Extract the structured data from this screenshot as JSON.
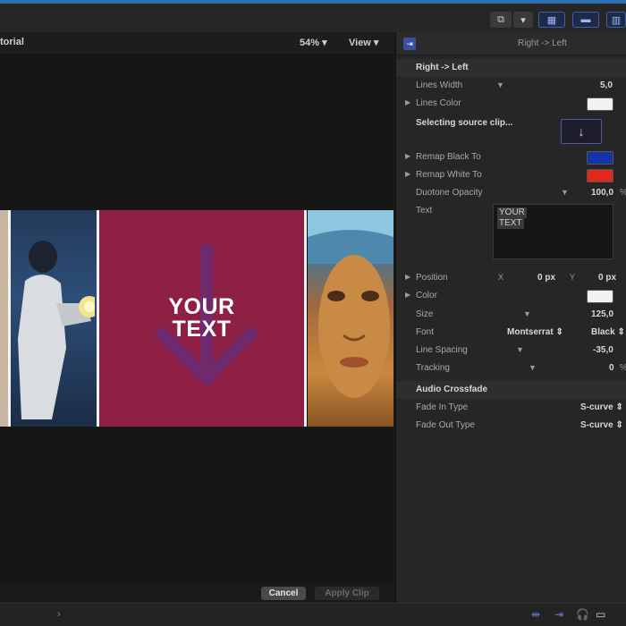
{
  "viewer": {
    "title": "torial",
    "zoom": "54%",
    "view_label": "View",
    "overlay_text_line1": "YOUR",
    "overlay_text_line2": "TEXT"
  },
  "actions": {
    "cancel": "Cancel",
    "apply": "Apply Clip"
  },
  "inspector": {
    "header_title": "Right -> Left",
    "section_title": "Right -> Left",
    "lines_width_label": "Lines Width",
    "lines_width_value": "5,0",
    "lines_color_label": "Lines Color",
    "lines_color": "#f2f2f2",
    "source_clip_label": "Selecting source clip...",
    "remap_black_label": "Remap Black To",
    "remap_black_color": "#1433a8",
    "remap_white_label": "Remap White To",
    "remap_white_color": "#e0281c",
    "duotone_label": "Duotone Opacity",
    "duotone_value": "100,0",
    "duotone_unit": "%",
    "text_label": "Text",
    "text_value_line1": "YOUR",
    "text_value_line2": "TEXT",
    "position_label": "Position",
    "position_x_label": "X",
    "position_x_value": "0 px",
    "position_y_label": "Y",
    "position_y_value": "0 px",
    "color_label": "Color",
    "color_value": "#f2f2f2",
    "size_label": "Size",
    "size_value": "125,0",
    "font_label": "Font",
    "font_value": "Montserrat",
    "font_style_value": "Black",
    "line_spacing_label": "Line Spacing",
    "line_spacing_value": "-35,0",
    "tracking_label": "Tracking",
    "tracking_value": "0",
    "tracking_unit": "%",
    "audio_section": "Audio Crossfade",
    "fade_in_label": "Fade In Type",
    "fade_in_value": "S-curve",
    "fade_out_label": "Fade Out Type",
    "fade_out_value": "S-curve"
  },
  "colors": {
    "accent": "#3f5ea8",
    "title_bg": "#8e2045"
  }
}
